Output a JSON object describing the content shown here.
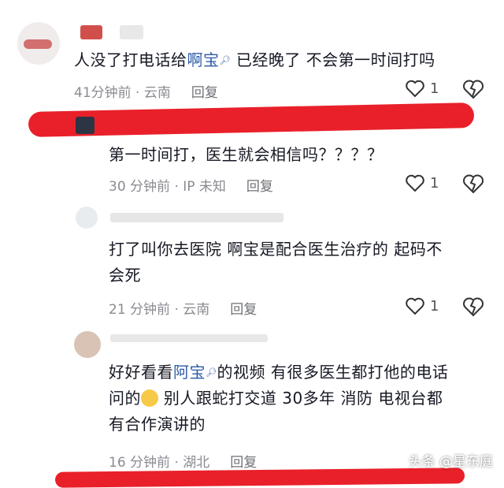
{
  "comments": [
    {
      "text_pre": "人没了打电话给",
      "mention": "啊宝",
      "text_post": " 已经晚了 不会第一时间打吗",
      "time_loc": "41分钟前 · 云南",
      "reply": "回复",
      "likes": "1"
    },
    {
      "text": "第一时间打，医生就会相信吗？？？？",
      "time_loc": "30 分钟前 · IP 未知",
      "reply": "回复",
      "likes": "1"
    },
    {
      "line1": "打了叫你去医院 啊宝是配合医生治疗的 起码不",
      "line2": "会死",
      "time_loc": "21 分钟前 · 云南",
      "reply": "回复",
      "likes": "1"
    },
    {
      "l1_pre": "好好看看",
      "mention": "阿宝",
      "l1_post": "的视频 有很多医生都打他的电话",
      "l2_pre": "问的",
      "l2_post": " 别人跟蛇打交道 30多年 消防 电视台都",
      "line3": "有合作演讲的",
      "time_loc": "16 分钟前 · 湖北",
      "reply": "回复"
    }
  ],
  "watermark": "头条 @星东庭",
  "colors": {
    "mention": "#2c5aa8",
    "highlight": "#e9202a",
    "meta": "#8a8b91"
  }
}
